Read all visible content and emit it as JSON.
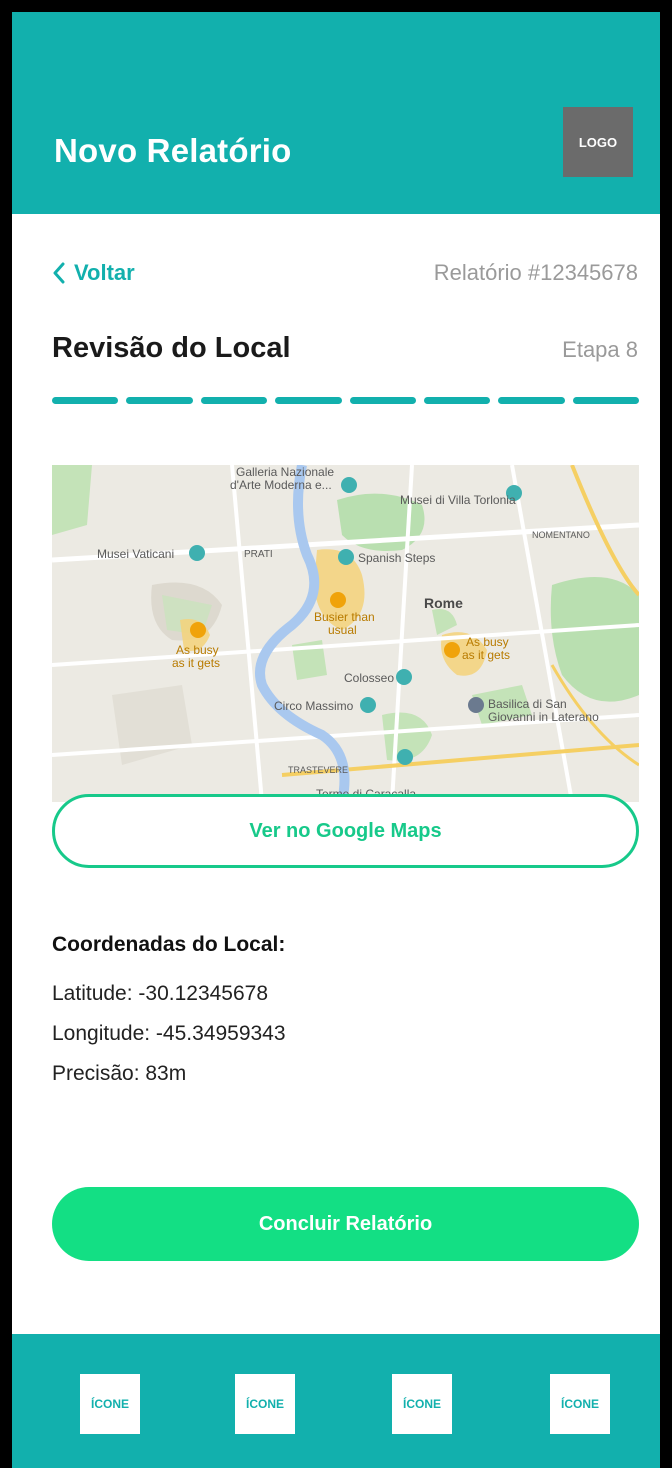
{
  "header": {
    "title": "Novo Relatório",
    "logo_text": "LOGO"
  },
  "subheader": {
    "back_label": "Voltar",
    "report_number": "Relatório #12345678"
  },
  "step": {
    "title": "Revisão do Local",
    "label": "Etapa 8",
    "segments": 8,
    "completed": 8
  },
  "map": {
    "labels": {
      "galleria": "Galleria Nazionale",
      "galleria2": "d'Arte Moderna e...",
      "villa": "Musei di Villa Torlonia",
      "vaticani": "Musei Vaticani",
      "spanish": "Spanish Steps",
      "busier": "Busier than",
      "busier2": "usual",
      "rome": "Rome",
      "busy1": "As busy",
      "busy1b": "as it gets",
      "busy2": "As busy",
      "busy2b": "as it gets",
      "colosseo": "Colosseo",
      "circo": "Circo Massimo",
      "basilica": "Basilica di San",
      "basilica2": "Giovanni in Laterano",
      "terme": "Terme di Caracalla",
      "prati": "PRATI",
      "nomentano": "NOMENTANO",
      "trastevere": "TRASTEVERE"
    }
  },
  "maps_button": {
    "label": "Ver no Google Maps"
  },
  "coordinates": {
    "title": "Coordenadas do Local:",
    "latitude": "Latitude: -30.12345678",
    "longitude": "Longitude: -45.34959343",
    "precision": "Precisão: 83m"
  },
  "submit": {
    "label": "Concluir Relatório"
  },
  "bottom_nav": {
    "items": [
      {
        "label": "ÍCONE"
      },
      {
        "label": "ÍCONE"
      },
      {
        "label": "ÍCONE"
      },
      {
        "label": "ÍCONE"
      }
    ]
  },
  "colors": {
    "primary": "#12b0ad",
    "accent_green": "#13df84",
    "outline_green": "#17c98a"
  }
}
